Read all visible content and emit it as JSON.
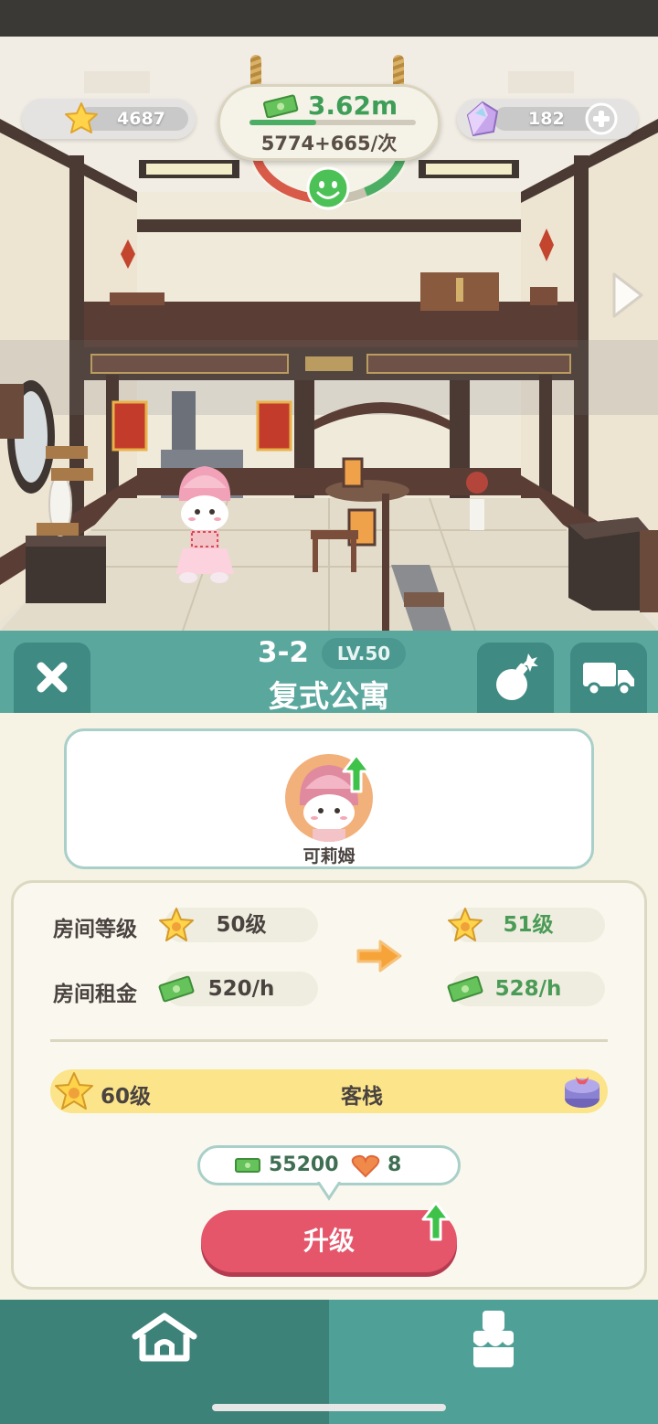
{
  "hud": {
    "stars": "4687",
    "gems": "182",
    "money_total": "3.62m",
    "money_rate": "5774+665/次",
    "money_progress": 0.4
  },
  "room": {
    "code": "3-2",
    "level_badge": "LV.50",
    "name": "复式公寓"
  },
  "character": {
    "name": "可莉姆"
  },
  "stats": {
    "level_label": "房间等级",
    "level_current": "50级",
    "level_next": "51级",
    "rent_label": "房间租金",
    "rent_current": "520/h",
    "rent_next": "528/h"
  },
  "unlock": {
    "level": "60级",
    "name": "客栈"
  },
  "cost": {
    "money": "55200",
    "hearts": "8"
  },
  "actions": {
    "upgrade_label": "升级"
  },
  "colors": {
    "teal": "#5aa79e",
    "teal_dark": "#3d8279",
    "upgrade": "#e5566b",
    "money_green": "#3e9e57"
  },
  "icons": [
    "star-icon",
    "gem-icon",
    "plus-icon",
    "cash-icon",
    "smiley-icon",
    "close-icon",
    "bomb-icon",
    "truck-icon",
    "up-arrow-icon",
    "right-arrow-icon",
    "gift-box-icon",
    "heart-icon",
    "home-icon",
    "paint-bucket-icon",
    "next-arrow-icon"
  ]
}
